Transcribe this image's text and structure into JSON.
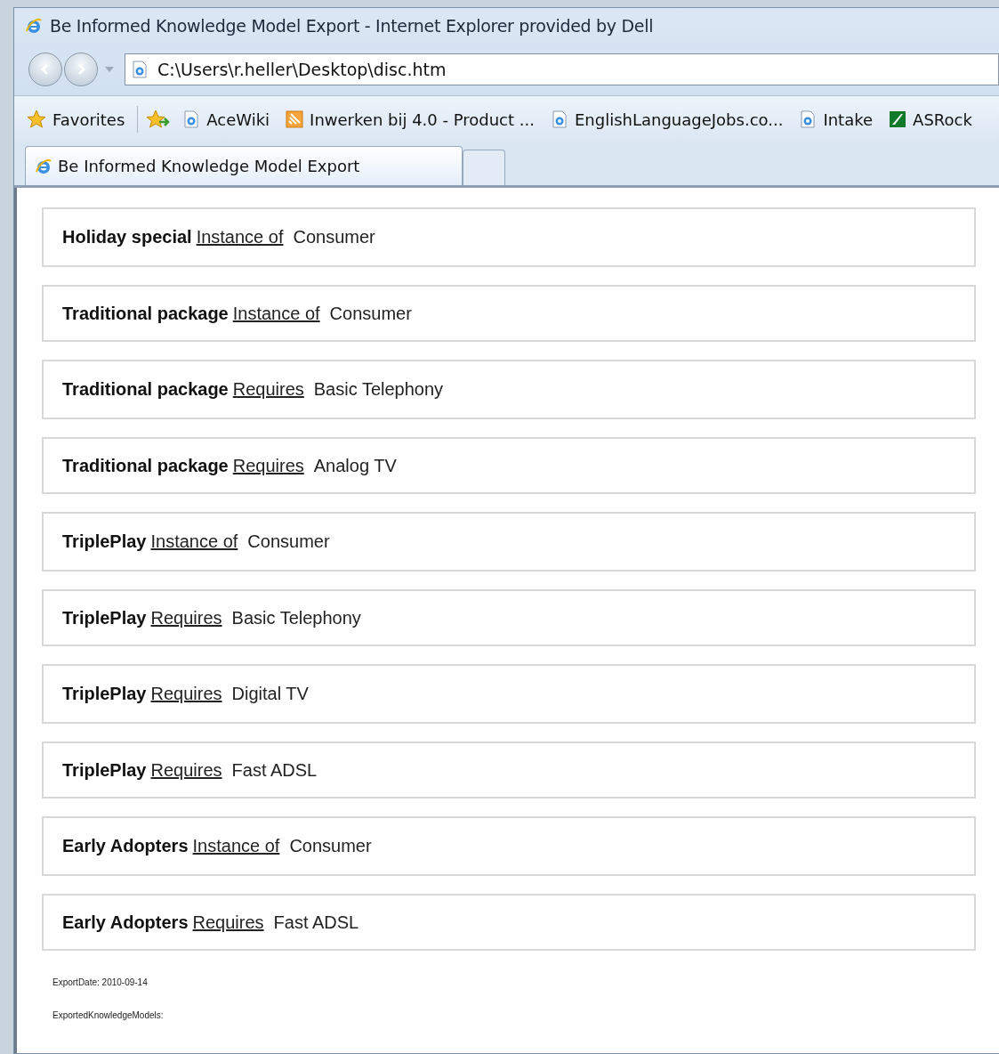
{
  "window": {
    "title": "Be Informed Knowledge Model Export - Internet Explorer provided by Dell"
  },
  "address_bar": {
    "value": "C:\\Users\\r.heller\\Desktop\\disc.htm"
  },
  "favorites_bar": {
    "label": "Favorites",
    "items": [
      {
        "label": "AceWiki",
        "kind": "page"
      },
      {
        "label": "Inwerken bij 4.0 - Product ...",
        "kind": "feed"
      },
      {
        "label": "EnglishLanguageJobs.co...",
        "kind": "page"
      },
      {
        "label": "Intake",
        "kind": "page"
      },
      {
        "label": "ASRock",
        "kind": "site"
      }
    ]
  },
  "tabs": [
    {
      "label": "Be Informed Knowledge Model Export",
      "selected": true
    },
    {
      "selected": false
    }
  ],
  "relations": [
    {
      "subject": "Holiday special",
      "relation": "Instance of",
      "object": "Consumer"
    },
    {
      "subject": "Traditional package",
      "relation": "Instance of",
      "object": "Consumer"
    },
    {
      "subject": "Traditional package",
      "relation": "Requires",
      "object": "Basic Telephony"
    },
    {
      "subject": "Traditional package",
      "relation": "Requires",
      "object": "Analog TV"
    },
    {
      "subject": "TriplePlay",
      "relation": "Instance of",
      "object": "Consumer"
    },
    {
      "subject": "TriplePlay",
      "relation": "Requires",
      "object": "Basic Telephony"
    },
    {
      "subject": "TriplePlay",
      "relation": "Requires",
      "object": "Digital TV"
    },
    {
      "subject": "TriplePlay",
      "relation": "Requires",
      "object": "Fast ADSL"
    },
    {
      "subject": "Early Adopters",
      "relation": "Instance of",
      "object": "Consumer"
    },
    {
      "subject": "Early Adopters",
      "relation": "Requires",
      "object": "Fast ADSL"
    }
  ],
  "footer": [
    "ExportDate: 2010-09-14",
    "ExportedKnowledgeModels:"
  ]
}
